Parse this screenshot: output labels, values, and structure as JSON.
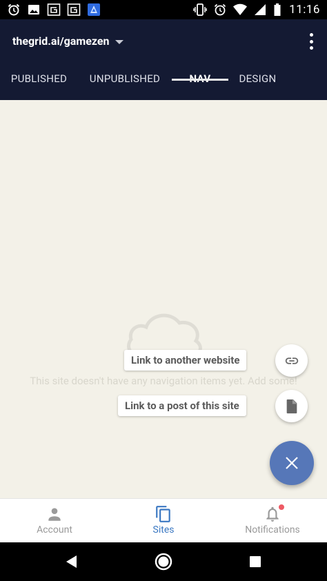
{
  "status_bar": {
    "time": "11:16",
    "left_icons": [
      "alarm-app-icon",
      "image-icon",
      "g-app-icon",
      "g-app-icon",
      "game-app-icon"
    ],
    "right_icons": [
      "vibrate-icon",
      "alarm-icon",
      "wifi-icon",
      "signal-icon",
      "battery-icon"
    ]
  },
  "header": {
    "site_name": "thegrid.ai/gamezen"
  },
  "tabs": [
    {
      "label": "PUBLISHED",
      "active": false
    },
    {
      "label": "UNPUBLISHED",
      "active": false
    },
    {
      "label": "NAV",
      "active": true
    },
    {
      "label": "DESIGN",
      "active": false
    }
  ],
  "empty_state": {
    "message": "This site doesn't have any navigation items yet. Add some!"
  },
  "fab_menu": {
    "link_website_label": "Link to another website",
    "link_post_label": "Link to a post of this site"
  },
  "bottom_nav": [
    {
      "label": "Account",
      "icon": "person-icon",
      "active": false
    },
    {
      "label": "Sites",
      "icon": "copy-icon",
      "active": true
    },
    {
      "label": "Notifications",
      "icon": "bell-icon",
      "active": false,
      "badge": true
    }
  ],
  "colors": {
    "app_bar": "#141a33",
    "accent": "#5677b8",
    "active_nav": "#3b78c2",
    "content_bg": "#f3f1e8",
    "badge": "#ee5a64"
  }
}
